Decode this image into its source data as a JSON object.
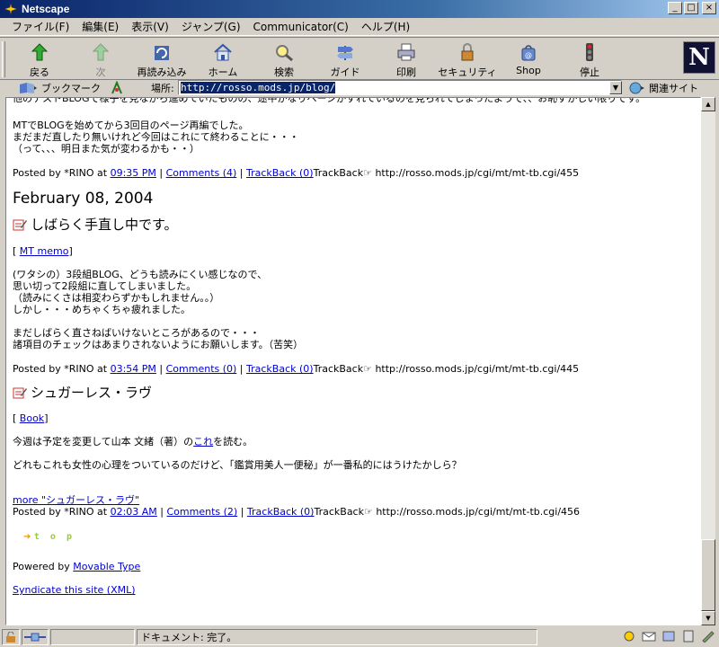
{
  "window": {
    "title": "Netscape"
  },
  "menu": [
    "ファイル(F)",
    "編集(E)",
    "表示(V)",
    "ジャンプ(G)",
    "Communicator(C)",
    "ヘルプ(H)"
  ],
  "toolbar": {
    "back": "戻る",
    "forward": "次",
    "reload": "再読み込み",
    "home": "ホーム",
    "search": "検索",
    "guide": "ガイド",
    "print": "印刷",
    "security": "セキュリティ",
    "shop": "Shop",
    "stop": "停止"
  },
  "location": {
    "bookmarks": "ブックマーク",
    "label": "場所:",
    "url": "http://rosso.mods.jp/blog/",
    "related": "関連サイト"
  },
  "content": {
    "top_line": "他のテストBLOGで様子を見ながら進めていたものの、途中かなりページがずれているのを見られてしまったようで、、お恥ずかしい限りです。",
    "e0_p1": "MTでBLOGを始めてから3回目のページ再編でした。",
    "e0_p2": "まだまだ直したり無いけれど今回はこれにて終わることに・・・",
    "e0_p3": "（って、、、明日また気が変わるかも・・）",
    "e0_posted_by": "Posted by *RINO at ",
    "e0_time": "09:35 PM",
    "e0_comments": "Comments (4)",
    "e0_trackback": "TrackBack (0)",
    "e0_tb_url": "TrackBack☞ http://rosso.mods.jp/cgi/mt/mt-tb.cgi/455",
    "date": "February 08, 2004",
    "e1_title": "しばらく手直し中です。",
    "e1_cat": "MT memo",
    "e1_p1": "(ワタシの）3段組BLOG、どうも読みにくい感じなので、",
    "e1_p2": "思い切って2段組に直してしまいました。",
    "e1_p3": "（読みにくさは相変わらずかもしれません。。）",
    "e1_p4": "しかし・・・めちゃくちゃ疲れました。",
    "e1_p5": "まだしばらく直さねばいけないところがあるので・・・",
    "e1_p6": "諸項目のチェックはあまりされないようにお願いします。（苦笑）",
    "e1_posted_by": "Posted by *RINO at ",
    "e1_time": "03:54 PM",
    "e1_comments": "Comments (0)",
    "e1_trackback": "TrackBack (0)",
    "e1_tb_url": "TrackBack☞ http://rosso.mods.jp/cgi/mt/mt-tb.cgi/445",
    "e2_title": "シュガーレス・ラヴ",
    "e2_cat": "Book",
    "e2_p1_pre": "今週は予定を変更して山本 文緒（著）の",
    "e2_p1_link": "これ",
    "e2_p1_post": "を読む。",
    "e2_p2": "どれもこれも女性の心理をついているのだけど、「鑑賞用美人一便秘」が一番私的にはうけたかしら？",
    "e2_more": "more \"シュガーレス・ラヴ\"",
    "e2_posted_by": "Posted by *RINO at ",
    "e2_time": "02:03 AM",
    "e2_comments": "Comments (2)",
    "e2_trackback": "TrackBack (0)",
    "e2_tb_url": "TrackBack☞ http://rosso.mods.jp/cgi/mt/mt-tb.cgi/456",
    "top": "t o p",
    "powered_pre": "Powered by ",
    "powered_link": "Movable Type",
    "syndicate": "Syndicate this site (XML)",
    "sep": " | "
  },
  "status": {
    "text": "ドキュメント: 完了。"
  }
}
